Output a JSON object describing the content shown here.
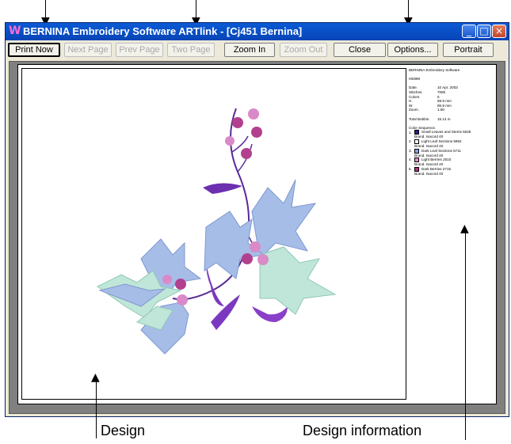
{
  "window": {
    "title": "BERNINA Embroidery Software ARTlink - [Cj451          Bernina]",
    "controls": {
      "minimize": "_",
      "maximize": "□",
      "close": "×"
    }
  },
  "toolbar": {
    "print_now": "Print Now",
    "next_page": "Next Page",
    "prev_page": "Prev Page",
    "two_page": "Two Page",
    "zoom_in": "Zoom In",
    "zoom_out": "Zoom Out",
    "close": "Close",
    "options": "Options...",
    "portrait": "Portrait"
  },
  "annotations": {
    "design": "Design",
    "design_information": "Design information"
  },
  "info": {
    "software": "BERNINA Embroidery Software",
    "design_name": "HE899",
    "fields": [
      {
        "label": "Date.",
        "value": "10 Apr, 2003"
      },
      {
        "label": "Stitches.",
        "value": "7080"
      },
      {
        "label": "Colors.",
        "value": "5"
      },
      {
        "label": "H.",
        "value": "58.8 mm"
      },
      {
        "label": "W.",
        "value": "85.8 mm"
      },
      {
        "label": "Zoom.",
        "value": "1.50"
      }
    ],
    "bobbin_label": "Total Bobbin.",
    "bobbin_value": "15.14 m",
    "color_sequence_title": "Color Sequence.",
    "color_sequence": [
      {
        "num": "1.",
        "color": "#3a1a8a",
        "name": "Small Leaves and Stems 5525",
        "brand": "Brand.  Isacord 40"
      },
      {
        "num": "2.",
        "color": "#ffffff",
        "name": "Light Leaf Sections 5962",
        "brand": "Brand.  Isacord 40"
      },
      {
        "num": "3.",
        "color": "#8aa0e6",
        "name": "Dark Leaf Sections 5711",
        "brand": "Brand.  Isacord 40"
      },
      {
        "num": "4.",
        "color": "#e28ec8",
        "name": "Light Berries 2510",
        "brand": "Brand.  Isacord 40"
      },
      {
        "num": "5.",
        "color": "#b0357a",
        "name": "Dark Berries 2715",
        "brand": "Brand.  Isacord 40"
      }
    ]
  },
  "colors": {
    "leaf_blue": "#a6bde8",
    "leaf_mint": "#bfe6d8",
    "stem_purple": "#5a2a9a",
    "berry_pink": "#d98ac8",
    "berry_magenta": "#b2408f"
  }
}
